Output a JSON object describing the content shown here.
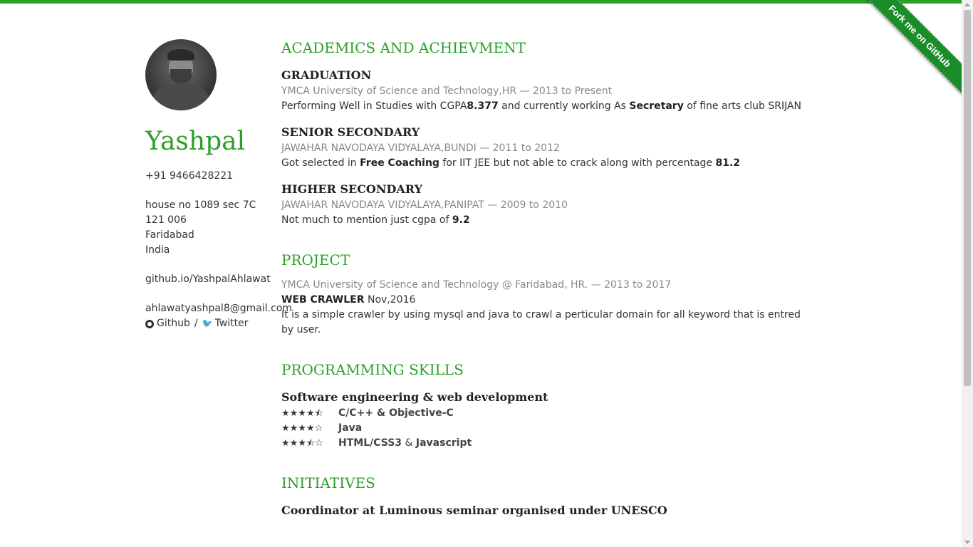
{
  "ribbon": {
    "label": "Fork me on GitHub"
  },
  "profile": {
    "name": "Yashpal",
    "phone": "+91 9466428221",
    "address": [
      "house no 1089 sec 7C",
      "121 006",
      "Faridabad",
      "India"
    ],
    "website": "github.io/YashpalAhlawat",
    "email": "ahlawatyashpal8@gmail.com",
    "github_label": "Github",
    "separator": "/",
    "twitter_label": "Twitter"
  },
  "academics": {
    "title": "ACADEMICS AND ACHIEVMENT",
    "entries": [
      {
        "title": "GRADUATION",
        "meta": "YMCA University of Science and Technology,HR  —  2013 to Present",
        "desc_parts": [
          "Performing Well in Studies with CGPA",
          "8.377",
          " and currently working As ",
          "Secretary",
          " of fine arts club SRIJAN"
        ]
      },
      {
        "title": "SENIOR SECONDARY",
        "meta": "JAWAHAR NAVODAYA VIDYALAYA,BUNDI  —  2011 to 2012",
        "desc_parts": [
          "Got selected in ",
          "Free Coaching",
          " for IIT JEE but not able to crack along with percentage ",
          "81.2"
        ]
      },
      {
        "title": "HIGHER SECONDARY",
        "meta": "JAWAHAR NAVODAYA VIDYALAYA,PANIPAT  —  2009 to 2010",
        "desc_parts": [
          "Not much to mention just cgpa of ",
          "9.2"
        ]
      }
    ]
  },
  "project": {
    "title": "PROJECT",
    "meta": "YMCA University of Science and Technology  @ Faridabad, HR.  —  2013 to 2017",
    "name": "WEB CRAWLER",
    "date": " Nov,2016",
    "desc": "It is a simple crawler by using mysql and java to crawl a perticular domain for all keyword that is entred by user."
  },
  "skills": {
    "title": "PROGRAMMING SKILLS",
    "group": "Software engineering & web development",
    "items": [
      {
        "rating": 4.5,
        "stars": "★★★★⯪",
        "name": "C/C++ & Objective-C"
      },
      {
        "rating": 4,
        "stars": "★★★★☆",
        "name": "Java"
      },
      {
        "rating": 3.5,
        "stars": "★★★⯪☆",
        "name_a": "HTML/CSS3",
        "amp": " & ",
        "name_b": "Javascript"
      }
    ]
  },
  "initiatives": {
    "title": "INITIATIVES",
    "first": "Coordinator at Luminous seminar organised under UNESCO"
  }
}
